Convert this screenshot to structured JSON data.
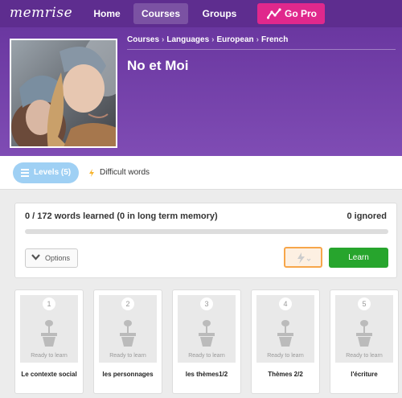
{
  "nav": {
    "logo": "memrise",
    "home": "Home",
    "courses": "Courses",
    "groups": "Groups",
    "gopro": "Go Pro",
    "brand_color": "#5e2d8f",
    "gopro_color": "#e0288c"
  },
  "header": {
    "breadcrumbs": [
      "Courses",
      "Languages",
      "European",
      "French"
    ],
    "title": "No et Moi"
  },
  "tabs": {
    "levels": "Levels (5)",
    "difficult": "Difficult words"
  },
  "progress": {
    "words_learned": "0 / 172 words learned (0 in long term memory)",
    "ignored": "0 ignored",
    "fraction": 0,
    "options_label": "Options",
    "learn_label": "Learn",
    "learn_color": "#27a52d"
  },
  "levels": [
    {
      "number": "1",
      "status": "Ready to learn",
      "name": "Le contexte social"
    },
    {
      "number": "2",
      "status": "Ready to learn",
      "name": "les personnages"
    },
    {
      "number": "3",
      "status": "Ready to learn",
      "name": "les thèmes1/2"
    },
    {
      "number": "4",
      "status": "Ready to learn",
      "name": "Thèmes 2/2"
    },
    {
      "number": "5",
      "status": "Ready to learn",
      "name": "l'écriture"
    }
  ]
}
